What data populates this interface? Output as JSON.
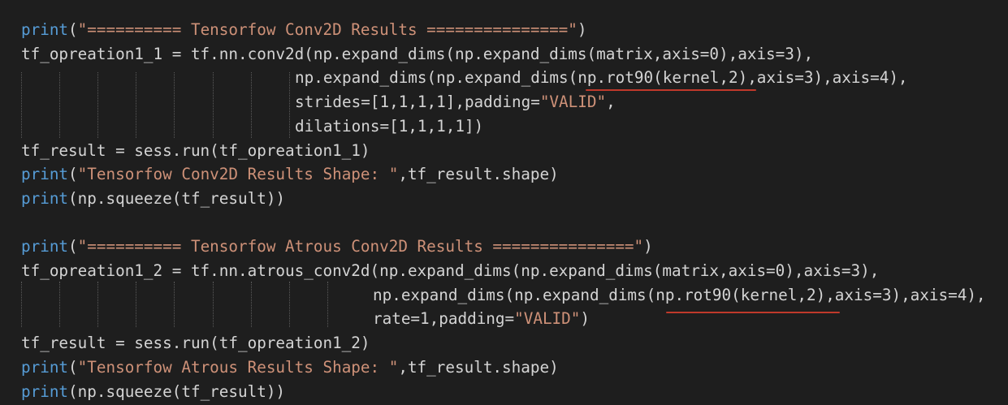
{
  "code": {
    "block1": {
      "l1": {
        "fn": "print",
        "open": "(",
        "str": "\"========== Tensorfow Conv2D Results ===============\"",
        "close": ")"
      },
      "l2": "tf_opreation1_1 = tf.nn.conv2d(np.expand_dims(np.expand_dims(matrix,axis=0),axis=3),",
      "l3": "np.expand_dims(np.expand_dims(np.rot90(kernel,2),axis=3),axis=4),",
      "l4": {
        "text": "strides=[1,1,1,1],padding=",
        "str": "\"VALID\"",
        "close": ","
      },
      "l5": "dilations=[1,1,1,1])",
      "l6": "tf_result = sess.run(tf_opreation1_1)",
      "l7": {
        "fn": "print",
        "open": "(",
        "str": "\"Tensorfow Conv2D Results Shape: \"",
        "close": ",tf_result.shape)"
      },
      "l8": {
        "fn": "print",
        "rest": "(np.squeeze(tf_result))"
      }
    },
    "block2": {
      "l1": {
        "fn": "print",
        "open": "(",
        "str": "\"========== Tensorfow Atrous Conv2D Results ===============\"",
        "close": ")"
      },
      "l2": "tf_opreation1_2 = tf.nn.atrous_conv2d(np.expand_dims(np.expand_dims(matrix,axis=0),axis=3),",
      "l3": "np.expand_dims(np.expand_dims(np.rot90(kernel,2),axis=3),axis=4),",
      "l4": {
        "text": "rate=1,padding=",
        "str": "\"VALID\"",
        "close": ")"
      },
      "l5": "tf_result = sess.run(tf_opreation1_2)",
      "l6": {
        "fn": "print",
        "open": "(",
        "str": "\"Tensorfow Atrous Results Shape: \"",
        "close": ",tf_result.shape)"
      },
      "l7": {
        "fn": "print",
        "rest": "(np.squeeze(tf_result))"
      }
    }
  },
  "colors": {
    "background": "#1e1e1e",
    "default_text": "#d4d4d4",
    "keyword": "#569cd6",
    "string": "#ce9178",
    "underline": "#c0392b",
    "indent_guide": "#5a5a5a"
  }
}
